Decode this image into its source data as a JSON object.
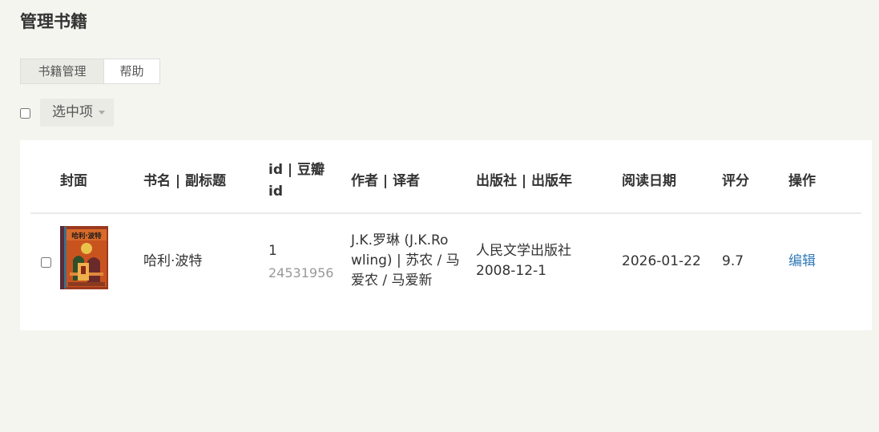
{
  "page": {
    "title": "管理书籍"
  },
  "tabs": [
    {
      "label": "书籍管理",
      "active": true
    },
    {
      "label": "帮助",
      "active": false
    }
  ],
  "toolbar": {
    "bulk_label": "选中项"
  },
  "table": {
    "headers": {
      "cover": "封面",
      "title": "书名 | 副标题",
      "id_line1": "id | 豆瓣",
      "id_line2": "id",
      "author": "作者 | 译者",
      "publisher": "出版社 | 出版年",
      "read_date": "阅读日期",
      "rating": "评分",
      "actions": "操作"
    },
    "rows": [
      {
        "cover_text": "哈利·波特",
        "title": "哈利·波特",
        "id": "1",
        "douban_id": "24531956",
        "author_line1": "J.K.罗琳 (J.K.Ro",
        "author_line2": "wling) | 苏农 / 马",
        "author_line3": "爱农 / 马爱新",
        "publisher": "人民文学出版社",
        "pub_year": "2008-12-1",
        "read_date": "2026-01-22",
        "rating": "9.7",
        "action_label": "编辑"
      }
    ]
  },
  "colors": {
    "background": "#f5f5f0",
    "link": "#337ab7",
    "tab_active": "#ebebe6"
  }
}
